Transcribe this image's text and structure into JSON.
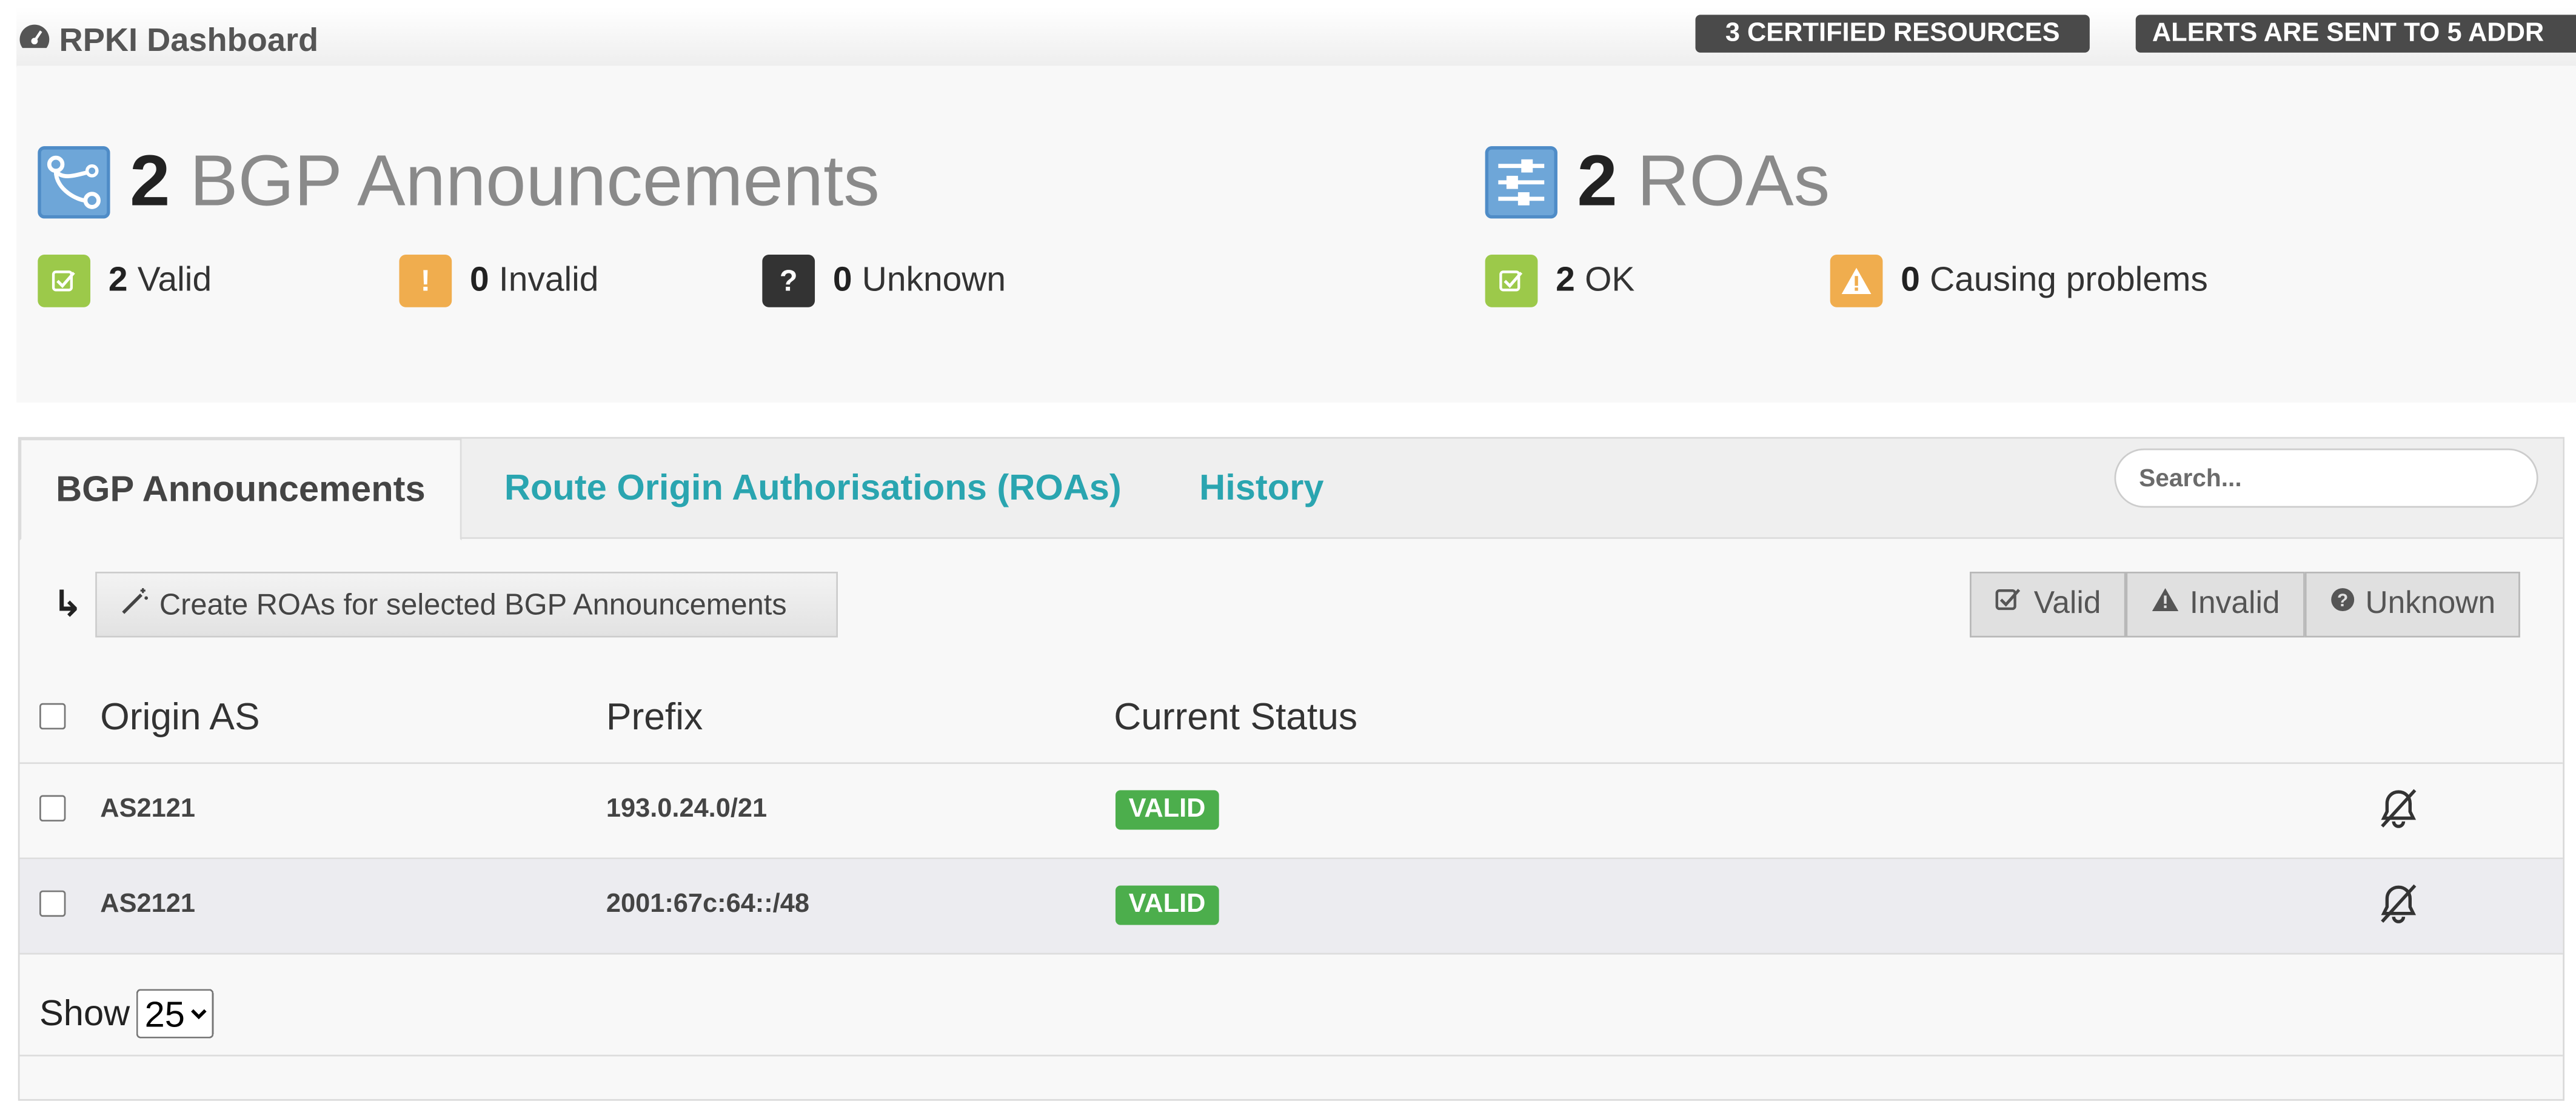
{
  "header": {
    "title": "RPKI Dashboard",
    "certified_badge": "3 CERTIFIED RESOURCES",
    "alerts_badge": "ALERTS ARE SENT TO 5 ADDR"
  },
  "bgp_summary": {
    "count": "2",
    "label": "BGP Announcements",
    "valid_count": "2",
    "valid_label": "Valid",
    "invalid_count": "0",
    "invalid_label": "Invalid",
    "unknown_count": "0",
    "unknown_label": "Unknown"
  },
  "roa_summary": {
    "count": "2",
    "label": "ROAs",
    "ok_count": "2",
    "ok_label": "OK",
    "problem_count": "0",
    "problem_label": "Causing problems"
  },
  "tabs": [
    {
      "label": "BGP Announcements",
      "active": true
    },
    {
      "label": "Route Origin Authorisations (ROAs)",
      "active": false
    },
    {
      "label": "History",
      "active": false
    }
  ],
  "search": {
    "placeholder": "Search..."
  },
  "toolbar": {
    "create_label": "Create ROAs for selected BGP Announcements",
    "filter_valid": "Valid",
    "filter_invalid": "Invalid",
    "filter_unknown": "Unknown"
  },
  "table": {
    "columns": [
      "Origin AS",
      "Prefix",
      "Current Status"
    ],
    "rows": [
      {
        "origin": "AS2121",
        "prefix": "193.0.24.0/21",
        "status": "VALID"
      },
      {
        "origin": "AS2121",
        "prefix": "2001:67c:64::/48",
        "status": "VALID"
      }
    ]
  },
  "pagination": {
    "show_label": "Show",
    "page_size": "25",
    "options": [
      "25"
    ]
  },
  "colors": {
    "accent_teal": "#2aa5b0",
    "valid_green": "#4cae4c",
    "summary_green": "#9cc94a",
    "warning_orange": "#f0ad4e",
    "icon_blue": "#6ea6d8"
  },
  "icons": {
    "dashboard": "dashboard-gauge-icon",
    "bgp": "route-branch-icon",
    "roa": "sliders-icon",
    "valid": "check-square-icon",
    "invalid": "exclamation-icon",
    "unknown": "question-icon",
    "warning": "warning-triangle-icon",
    "sort": "sort-arrow-icon",
    "wand": "magic-wand-icon",
    "muted_bell": "bell-slash-icon"
  }
}
